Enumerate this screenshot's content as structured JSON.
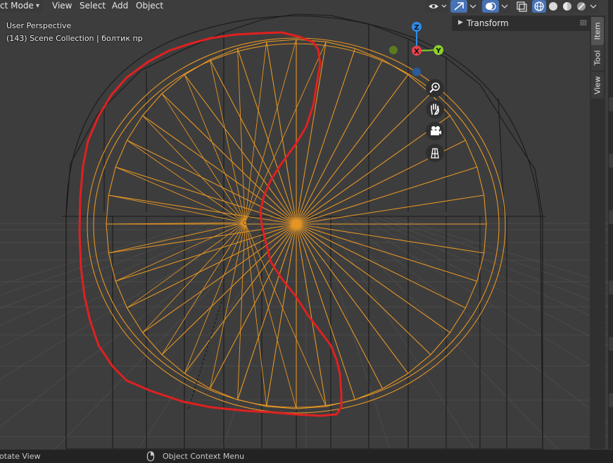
{
  "header": {
    "mode_label": "ct Mode",
    "menus": [
      "View",
      "Select",
      "Add",
      "Object"
    ]
  },
  "icons": {
    "mode_chevron": "chevron-down-icon",
    "visibility": "eye-icon",
    "gizmo_toggle": "gizmo-icon",
    "overlays": "overlays-icon",
    "xray": "xray-icon",
    "shading_wireframe": "wireframe-shading-icon",
    "shading_solid": "solid-shading-icon",
    "shading_material": "material-shading-icon",
    "shading_rendered": "rendered-shading-icon"
  },
  "viewport": {
    "perspective": "User Perspective",
    "collection_info": "(143) Scene Collection | болтик пр"
  },
  "axes_gizmo": {
    "z": "Z",
    "x": "X",
    "y": "Y",
    "colors": {
      "x": "#e8424d",
      "y": "#8ad12a",
      "z": "#2d8ceb"
    }
  },
  "nav_buttons": [
    {
      "name": "zoom-button",
      "icon": "zoom-icon"
    },
    {
      "name": "pan-button",
      "icon": "hand-icon"
    },
    {
      "name": "camera-view-button",
      "icon": "camera-icon"
    },
    {
      "name": "ortho-toggle-button",
      "icon": "grid-icon"
    }
  ],
  "npanel": {
    "section": "Transform",
    "tabs": [
      "Item",
      "Tool",
      "View"
    ],
    "active_tab": "Item"
  },
  "statusbar": {
    "left": "otate View",
    "middle": "Object Context Menu"
  },
  "colors": {
    "viewport_bg": "#3d3d3d",
    "selection_orange": "#e59524",
    "annotation_red": "#e02020",
    "active_blue": "#4772b3"
  }
}
